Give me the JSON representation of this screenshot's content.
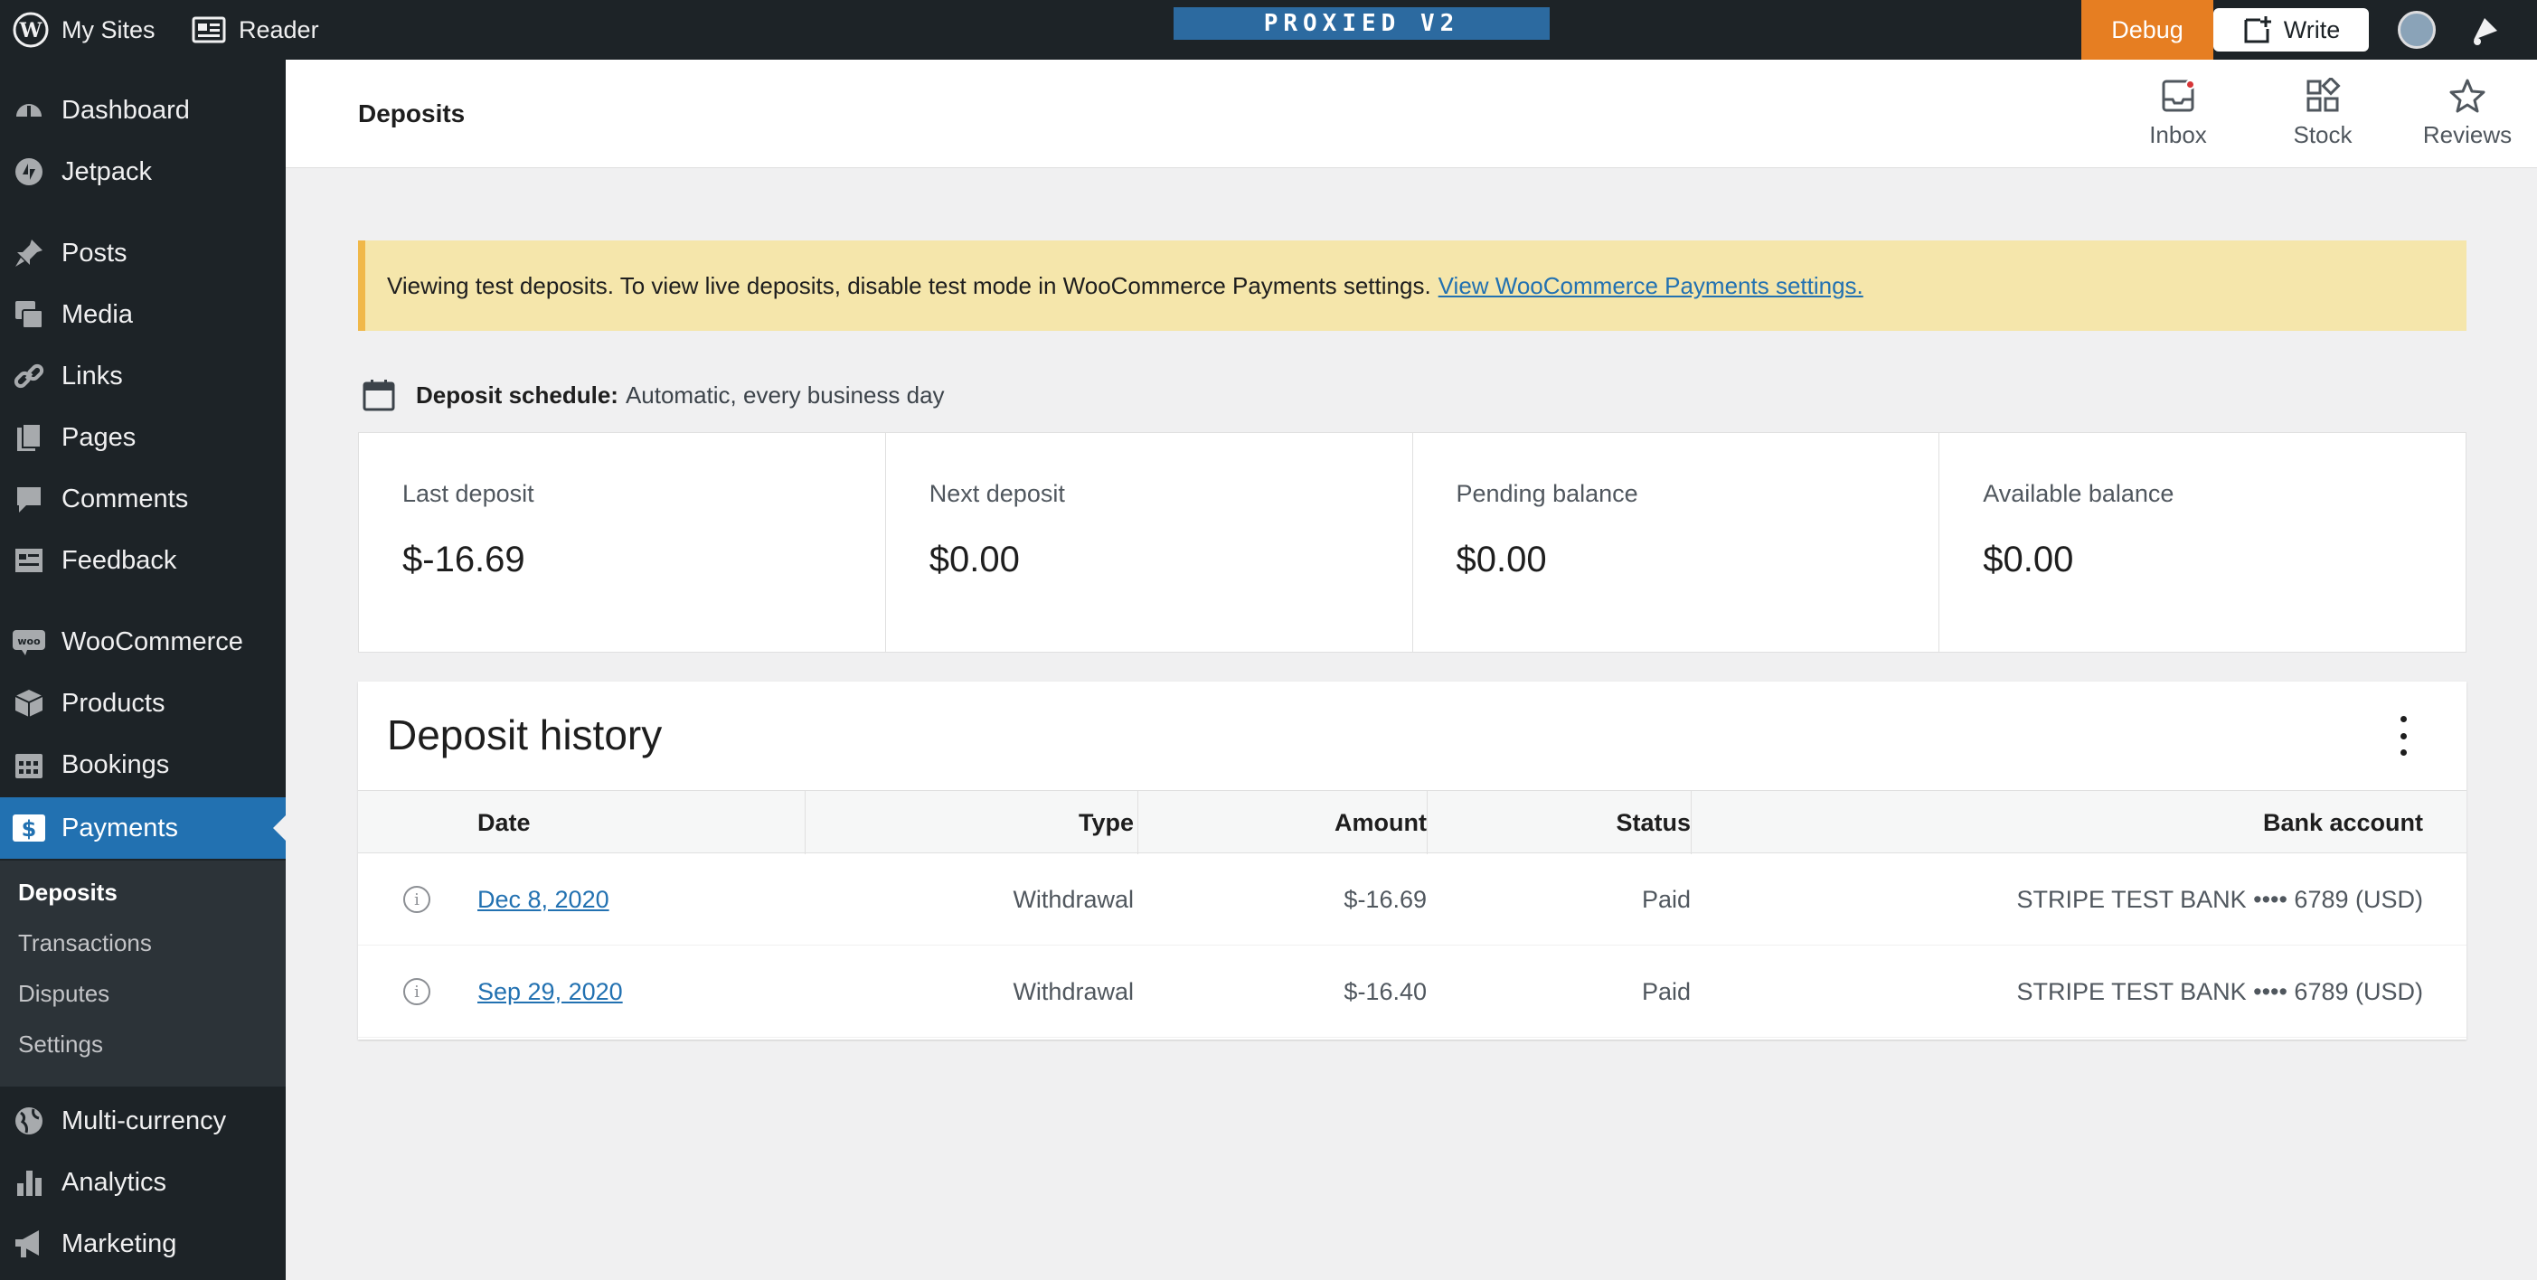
{
  "adminbar": {
    "my_sites": "My Sites",
    "reader": "Reader",
    "env_label": "PROXIED V2",
    "debug": "Debug",
    "write": "Write"
  },
  "sidebar": {
    "items": [
      {
        "label": "Dashboard",
        "icon": "dashboard-icon"
      },
      {
        "label": "Jetpack",
        "icon": "jetpack-icon"
      },
      {
        "label": "Posts",
        "icon": "pin-icon"
      },
      {
        "label": "Media",
        "icon": "media-icon"
      },
      {
        "label": "Links",
        "icon": "link-icon"
      },
      {
        "label": "Pages",
        "icon": "pages-icon"
      },
      {
        "label": "Comments",
        "icon": "comment-icon"
      },
      {
        "label": "Feedback",
        "icon": "feedback-icon"
      },
      {
        "label": "WooCommerce",
        "icon": "woo-icon"
      },
      {
        "label": "Products",
        "icon": "box-icon"
      },
      {
        "label": "Bookings",
        "icon": "calendar-icon"
      },
      {
        "label": "Payments",
        "icon": "dollar-icon"
      },
      {
        "label": "Multi-currency",
        "icon": "globe-icon"
      },
      {
        "label": "Analytics",
        "icon": "bar-chart-icon"
      },
      {
        "label": "Marketing",
        "icon": "megaphone-icon"
      }
    ],
    "submenu": [
      "Deposits",
      "Transactions",
      "Disputes",
      "Settings"
    ]
  },
  "header": {
    "title": "Deposits",
    "inbox": "Inbox",
    "stock": "Stock",
    "reviews": "Reviews"
  },
  "notice": {
    "text": "Viewing test deposits. To view live deposits, disable test mode in WooCommerce Payments settings.",
    "link": "View WooCommerce Payments settings."
  },
  "schedule": {
    "label": "Deposit schedule:",
    "value": "Automatic, every business day"
  },
  "summary": [
    {
      "label": "Last deposit",
      "value": "$-16.69"
    },
    {
      "label": "Next deposit",
      "value": "$0.00"
    },
    {
      "label": "Pending balance",
      "value": "$0.00"
    },
    {
      "label": "Available balance",
      "value": "$0.00"
    }
  ],
  "history": {
    "title": "Deposit history",
    "columns": {
      "date": "Date",
      "type": "Type",
      "amount": "Amount",
      "status": "Status",
      "bank": "Bank account"
    },
    "rows": [
      {
        "date": "Dec 8, 2020",
        "type": "Withdrawal",
        "amount": "$-16.69",
        "status": "Paid",
        "bank": "STRIPE TEST BANK •••• 6789 (USD)"
      },
      {
        "date": "Sep 29, 2020",
        "type": "Withdrawal",
        "amount": "$-16.40",
        "status": "Paid",
        "bank": "STRIPE TEST BANK •••• 6789 (USD)"
      }
    ]
  },
  "colors": {
    "admin_dark": "#1d2327",
    "accent_blue": "#2271b1",
    "debug_orange": "#e67e22",
    "notice_bg": "#f5e6ab",
    "notice_border": "#f0b849"
  }
}
